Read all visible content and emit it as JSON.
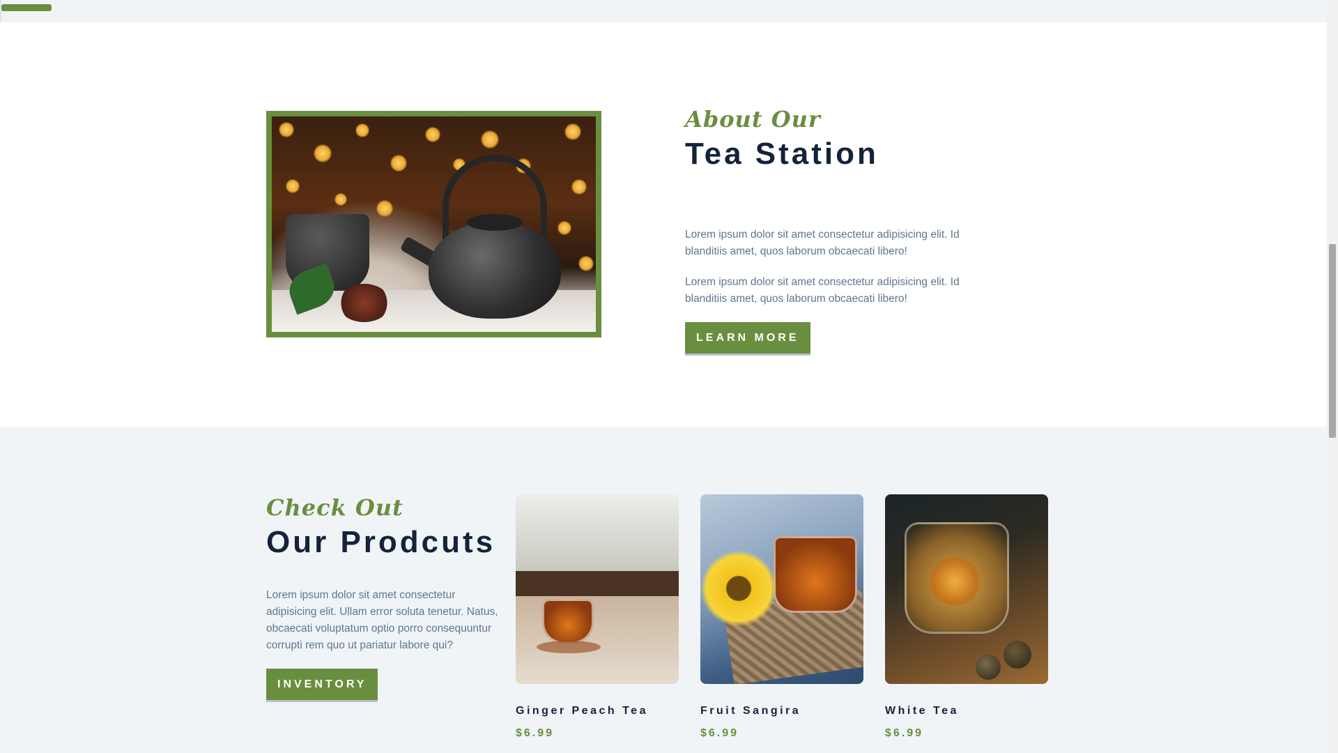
{
  "about": {
    "script_title": "About Our",
    "title": "Tea Station",
    "paragraph_1": "Lorem ipsum dolor sit amet consectetur adipisicing elit. Id blanditiis amet, quos laborum obcaecati libero!",
    "paragraph_2": "Lorem ipsum dolor sit amet consectetur adipisicing elit. Id blanditiis amet, quos laborum obcaecati libero!",
    "button_label": "LEARN MORE"
  },
  "products": {
    "script_title": "Check Out",
    "title": "Our Prodcuts",
    "paragraph": "Lorem ipsum dolor sit amet consectetur adipisicing elit. Ullam error soluta tenetur. Natus, obcaecati voluptatum optio porro consequuntur corrupti rem quo ut pariatur labore qui?",
    "button_label": "INVENTORY",
    "items": [
      {
        "name": "Ginger Peach Tea",
        "price": "$6.99"
      },
      {
        "name": "Fruit Sangira",
        "price": "$6.99"
      },
      {
        "name": "White Tea",
        "price": "$6.99"
      }
    ]
  },
  "colors": {
    "accent": "#6a8e3f",
    "heading": "#14233a",
    "body_text": "#5e7591",
    "section_bg": "#f0f4f7"
  },
  "icons": {
    "menu": "hamburger-menu-icon"
  }
}
